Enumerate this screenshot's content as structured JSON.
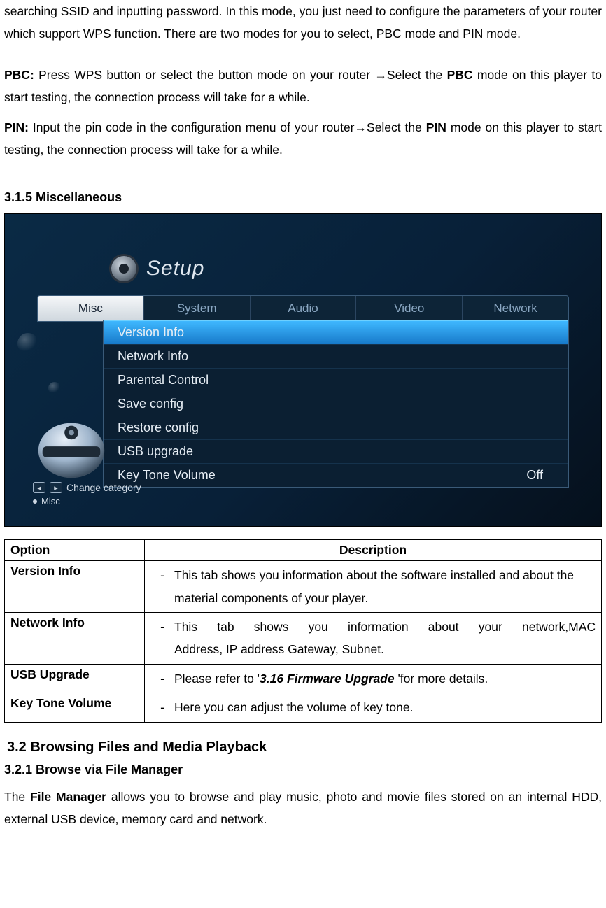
{
  "intro": {
    "p1": "searching SSID and inputting password. In this mode, you just need to configure the parameters of your router which support WPS function. There are two modes for you to select, PBC mode and PIN mode."
  },
  "pbc": {
    "label": "PBC:",
    "text_a": " Press WPS button or select the button mode on your router ",
    "arrow": "→",
    "text_b": "Select the ",
    "bold1": "PBC",
    "text_c": " mode on this player to start testing, the connection process will take for a while."
  },
  "pin": {
    "label": "PIN:",
    "text_a": " Input the pin code in the configuration menu of your router",
    "arrow": "→",
    "text_b": "Select the ",
    "bold1": "PIN",
    "text_c": " mode on this player to start testing, the connection process will take for a while."
  },
  "h_misc": "3.1.5 Miscellaneous",
  "setup": {
    "title": "Setup",
    "tabs": [
      "Misc",
      "System",
      "Audio",
      "Video",
      "Network"
    ],
    "items": [
      {
        "label": "Version Info",
        "value": "",
        "hl": true
      },
      {
        "label": "Network Info",
        "value": ""
      },
      {
        "label": "Parental Control",
        "value": ""
      },
      {
        "label": "Save config",
        "value": ""
      },
      {
        "label": "Restore config",
        "value": ""
      },
      {
        "label": "USB upgrade",
        "value": ""
      },
      {
        "label": "Key Tone Volume",
        "value": "Off"
      }
    ],
    "hint1": "Change category",
    "hint2": "Misc"
  },
  "table": {
    "head_option": "Option",
    "head_desc": "Description",
    "rows": [
      {
        "name": "Version Info",
        "desc_pre": "This tab shows you information about the software installed and about the material components of your player.",
        "desc_ref": "",
        "desc_post": ""
      },
      {
        "name": "Network Info",
        "desc_pre_line1": "This tab shows you information about your network,MAC",
        "desc_pre_line2": "Address, IP address Gateway, Subnet.",
        "desc_ref": "",
        "desc_post": ""
      },
      {
        "name": "USB Upgrade",
        "desc_pre": "Please refer to '",
        "desc_ref": "3.16 Firmware Upgrade",
        "desc_post": " 'for more details."
      },
      {
        "name": "Key Tone Volume",
        "desc_pre": "Here you can adjust the volume of key tone.",
        "desc_ref": "",
        "desc_post": ""
      }
    ]
  },
  "h_browse": "3.2 Browsing Files and Media Playback",
  "h_fm": "3.2.1 Browse via File Manager",
  "fm_para_a": "The ",
  "fm_para_bold": "File Manager",
  "fm_para_b": " allows you to browse and play music, photo and movie files stored on an internal HDD, external USB device, memory card and network."
}
